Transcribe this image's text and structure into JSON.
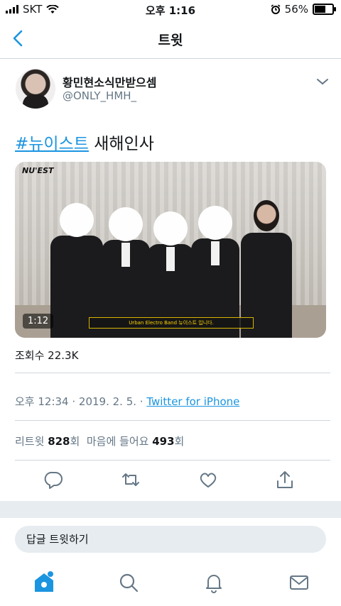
{
  "status_bar": {
    "carrier": "SKT",
    "time": "오후 1:16",
    "battery": "56%"
  },
  "nav": {
    "title": "트윗",
    "back_icon": "back-arrow-icon"
  },
  "tweet": {
    "author_name": "황민현소식만받으셈",
    "author_handle": "@ONLY_HMH_",
    "hashtag": "#뉴이스트",
    "text_rest": " 새해인사",
    "video": {
      "logo": "NU'EST",
      "duration": "1:12",
      "caption": "Urban Electro Band 뉴이스트 입니다."
    },
    "views": "조회수 22.3K",
    "time_date": "오후 12:34 · 2019. 2. 5. · ",
    "source": "Twitter for iPhone",
    "retweets_label": "리트윗",
    "retweets_count": "828",
    "retweets_unit": "회",
    "likes_label": "마음에 들어요",
    "likes_count": "493",
    "likes_unit": "회"
  },
  "reply": {
    "placeholder": "답글 트윗하기"
  },
  "colors": {
    "accent": "#1b95e0",
    "secondary_text": "#657786",
    "divider": "#cfd6dc"
  }
}
